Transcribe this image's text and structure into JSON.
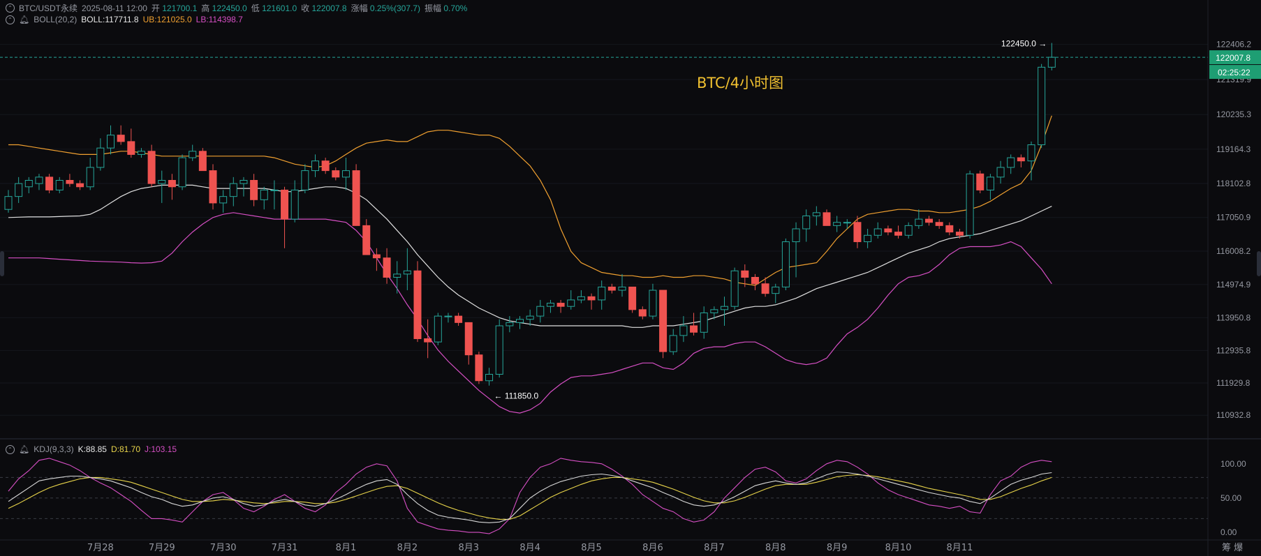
{
  "header": {
    "symbol": "BTC/USDT永续",
    "datetime": "2025-08-11 12:00",
    "open_label": "开",
    "open": "121700.1",
    "high_label": "高",
    "high": "122450.0",
    "low_label": "低",
    "low": "121601.0",
    "close_label": "收",
    "close": "122007.8",
    "change_label": "涨幅",
    "change": "0.25%(307.7)",
    "amplitude_label": "振幅",
    "amplitude": "0.70%"
  },
  "boll": {
    "name": "BOLL(20,2)",
    "mid": "BOLL:117711.8",
    "ub": "UB:121025.0",
    "lb": "LB:114398.7"
  },
  "kdj_header": {
    "name": "KDJ(9,3,3)",
    "k": "K:88.85",
    "d": "D:81.70",
    "j": "J:103.15"
  },
  "time_axis_right_label": "筹 爆",
  "colors": {
    "background": "#0b0b0e",
    "up": "#26a69a",
    "down": "#ef5350",
    "boll_mid": "#e0e0e0",
    "boll_ub": "#f0a030",
    "boll_lb": "#d64fc4",
    "k_line": "#d8d8d8",
    "d_line": "#e8d44a",
    "j_line": "#d64fc4",
    "annotation": "#f0c030",
    "price_tag": "#1e9e73"
  },
  "chart_data": {
    "type": "candlestick",
    "title": "BTC/4小时图",
    "x_tick_labels": [
      "7月28",
      "7月29",
      "7月30",
      "7月31",
      "8月1",
      "8月2",
      "8月3",
      "8月4",
      "8月5",
      "8月6",
      "8月7",
      "8月8",
      "8月9",
      "8月10",
      "8月11"
    ],
    "y_tick_labels": [
      "122406.2",
      "121319.9",
      "120235.3",
      "119164.3",
      "118102.8",
      "117050.9",
      "116008.2",
      "114974.9",
      "113950.8",
      "112935.8",
      "111929.8",
      "110932.8"
    ],
    "ylim": [
      110700,
      122700
    ],
    "current_price": "122007.8",
    "countdown": "02:25:22",
    "high_marker": "122450.0",
    "low_marker": "111850.0",
    "candles": [
      {
        "o": 117300,
        "h": 117900,
        "l": 117200,
        "c": 117700
      },
      {
        "o": 117700,
        "h": 118300,
        "l": 117500,
        "c": 118100
      },
      {
        "o": 118000,
        "h": 118300,
        "l": 117800,
        "c": 118200
      },
      {
        "o": 118100,
        "h": 118400,
        "l": 117900,
        "c": 118300
      },
      {
        "o": 118300,
        "h": 118400,
        "l": 117800,
        "c": 117900
      },
      {
        "o": 117900,
        "h": 118300,
        "l": 117800,
        "c": 118200
      },
      {
        "o": 118200,
        "h": 118400,
        "l": 118000,
        "c": 118100
      },
      {
        "o": 118100,
        "h": 118200,
        "l": 117900,
        "c": 118000
      },
      {
        "o": 118000,
        "h": 118900,
        "l": 117900,
        "c": 118600
      },
      {
        "o": 118600,
        "h": 119500,
        "l": 118500,
        "c": 119200
      },
      {
        "o": 119200,
        "h": 119900,
        "l": 119000,
        "c": 119600
      },
      {
        "o": 119600,
        "h": 119900,
        "l": 119300,
        "c": 119400
      },
      {
        "o": 119400,
        "h": 119800,
        "l": 118900,
        "c": 119000
      },
      {
        "o": 119000,
        "h": 119200,
        "l": 118900,
        "c": 119100
      },
      {
        "o": 119100,
        "h": 119300,
        "l": 118000,
        "c": 118100
      },
      {
        "o": 118100,
        "h": 118500,
        "l": 117500,
        "c": 118200
      },
      {
        "o": 118200,
        "h": 118400,
        "l": 117600,
        "c": 118000
      },
      {
        "o": 118000,
        "h": 119000,
        "l": 117900,
        "c": 118900
      },
      {
        "o": 118900,
        "h": 119300,
        "l": 118800,
        "c": 119100
      },
      {
        "o": 119100,
        "h": 119200,
        "l": 118500,
        "c": 118500
      },
      {
        "o": 118500,
        "h": 118700,
        "l": 117300,
        "c": 117500
      },
      {
        "o": 117500,
        "h": 117900,
        "l": 117200,
        "c": 117700
      },
      {
        "o": 117700,
        "h": 118300,
        "l": 117400,
        "c": 118100
      },
      {
        "o": 118100,
        "h": 118300,
        "l": 117700,
        "c": 118200
      },
      {
        "o": 118200,
        "h": 118400,
        "l": 117400,
        "c": 117600
      },
      {
        "o": 117600,
        "h": 118000,
        "l": 117300,
        "c": 117900
      },
      {
        "o": 117900,
        "h": 118200,
        "l": 117300,
        "c": 117900
      },
      {
        "o": 117900,
        "h": 118000,
        "l": 116100,
        "c": 117000
      },
      {
        "o": 117000,
        "h": 118200,
        "l": 116900,
        "c": 117900
      },
      {
        "o": 117900,
        "h": 118700,
        "l": 117800,
        "c": 118500
      },
      {
        "o": 118500,
        "h": 119000,
        "l": 118300,
        "c": 118800
      },
      {
        "o": 118800,
        "h": 118900,
        "l": 118400,
        "c": 118500
      },
      {
        "o": 118500,
        "h": 118600,
        "l": 118200,
        "c": 118300
      },
      {
        "o": 118300,
        "h": 118900,
        "l": 117900,
        "c": 118500
      },
      {
        "o": 118500,
        "h": 118700,
        "l": 116800,
        "c": 116800
      },
      {
        "o": 116800,
        "h": 117000,
        "l": 115900,
        "c": 115900
      },
      {
        "o": 115900,
        "h": 116100,
        "l": 115400,
        "c": 115800
      },
      {
        "o": 115800,
        "h": 116100,
        "l": 115000,
        "c": 115200
      },
      {
        "o": 115200,
        "h": 115700,
        "l": 114700,
        "c": 115300
      },
      {
        "o": 115300,
        "h": 116100,
        "l": 114800,
        "c": 115400
      },
      {
        "o": 115400,
        "h": 115700,
        "l": 113200,
        "c": 113300
      },
      {
        "o": 113300,
        "h": 113900,
        "l": 112700,
        "c": 113200
      },
      {
        "o": 113200,
        "h": 114100,
        "l": 113100,
        "c": 114000
      },
      {
        "o": 114000,
        "h": 114100,
        "l": 113800,
        "c": 114000
      },
      {
        "o": 114000,
        "h": 114100,
        "l": 113700,
        "c": 113800
      },
      {
        "o": 113800,
        "h": 113800,
        "l": 112500,
        "c": 112800
      },
      {
        "o": 112800,
        "h": 112900,
        "l": 111900,
        "c": 112000
      },
      {
        "o": 112000,
        "h": 112400,
        "l": 111850,
        "c": 112200
      },
      {
        "o": 112200,
        "h": 113900,
        "l": 112100,
        "c": 113700
      },
      {
        "o": 113700,
        "h": 114000,
        "l": 113500,
        "c": 113800
      },
      {
        "o": 113800,
        "h": 114000,
        "l": 113600,
        "c": 113900
      },
      {
        "o": 113900,
        "h": 114200,
        "l": 113700,
        "c": 114000
      },
      {
        "o": 114000,
        "h": 114500,
        "l": 113800,
        "c": 114300
      },
      {
        "o": 114300,
        "h": 114500,
        "l": 114100,
        "c": 114400
      },
      {
        "o": 114400,
        "h": 114500,
        "l": 114100,
        "c": 114300
      },
      {
        "o": 114300,
        "h": 114800,
        "l": 114200,
        "c": 114500
      },
      {
        "o": 114500,
        "h": 114800,
        "l": 114400,
        "c": 114600
      },
      {
        "o": 114600,
        "h": 114700,
        "l": 114200,
        "c": 114500
      },
      {
        "o": 114500,
        "h": 115100,
        "l": 114200,
        "c": 114900
      },
      {
        "o": 114900,
        "h": 115000,
        "l": 114700,
        "c": 114800
      },
      {
        "o": 114800,
        "h": 115300,
        "l": 114600,
        "c": 114900
      },
      {
        "o": 114900,
        "h": 114900,
        "l": 114100,
        "c": 114200
      },
      {
        "o": 114200,
        "h": 114300,
        "l": 113900,
        "c": 114000
      },
      {
        "o": 114000,
        "h": 115000,
        "l": 113900,
        "c": 114800
      },
      {
        "o": 114800,
        "h": 114800,
        "l": 112700,
        "c": 112900
      },
      {
        "o": 112900,
        "h": 113600,
        "l": 112800,
        "c": 113400
      },
      {
        "o": 113400,
        "h": 114000,
        "l": 113200,
        "c": 113700
      },
      {
        "o": 113700,
        "h": 114100,
        "l": 113400,
        "c": 113500
      },
      {
        "o": 113500,
        "h": 114300,
        "l": 113300,
        "c": 114100
      },
      {
        "o": 114100,
        "h": 114300,
        "l": 113900,
        "c": 114200
      },
      {
        "o": 114200,
        "h": 114600,
        "l": 113700,
        "c": 114300
      },
      {
        "o": 114300,
        "h": 115500,
        "l": 114200,
        "c": 115400
      },
      {
        "o": 115400,
        "h": 115600,
        "l": 114900,
        "c": 115200
      },
      {
        "o": 115200,
        "h": 115300,
        "l": 114800,
        "c": 115000
      },
      {
        "o": 115000,
        "h": 115200,
        "l": 114600,
        "c": 114700
      },
      {
        "o": 114700,
        "h": 115000,
        "l": 114400,
        "c": 114900
      },
      {
        "o": 114900,
        "h": 116400,
        "l": 114800,
        "c": 116300
      },
      {
        "o": 116300,
        "h": 116900,
        "l": 115200,
        "c": 116700
      },
      {
        "o": 116700,
        "h": 117300,
        "l": 116300,
        "c": 117100
      },
      {
        "o": 117100,
        "h": 117400,
        "l": 116800,
        "c": 117200
      },
      {
        "o": 117200,
        "h": 117300,
        "l": 116800,
        "c": 116800
      },
      {
        "o": 116800,
        "h": 117100,
        "l": 116600,
        "c": 116900
      },
      {
        "o": 116900,
        "h": 117000,
        "l": 116700,
        "c": 116900
      },
      {
        "o": 116900,
        "h": 117100,
        "l": 116100,
        "c": 116300
      },
      {
        "o": 116300,
        "h": 116700,
        "l": 116100,
        "c": 116500
      },
      {
        "o": 116500,
        "h": 116900,
        "l": 116400,
        "c": 116700
      },
      {
        "o": 116700,
        "h": 116800,
        "l": 116500,
        "c": 116600
      },
      {
        "o": 116600,
        "h": 116800,
        "l": 116400,
        "c": 116500
      },
      {
        "o": 116500,
        "h": 116900,
        "l": 116400,
        "c": 116800
      },
      {
        "o": 116800,
        "h": 117300,
        "l": 116700,
        "c": 117000
      },
      {
        "o": 117000,
        "h": 117100,
        "l": 116800,
        "c": 116900
      },
      {
        "o": 116900,
        "h": 117000,
        "l": 116700,
        "c": 116800
      },
      {
        "o": 116800,
        "h": 116900,
        "l": 116500,
        "c": 116600
      },
      {
        "o": 116600,
        "h": 116700,
        "l": 116400,
        "c": 116500
      },
      {
        "o": 116500,
        "h": 118500,
        "l": 116400,
        "c": 118400
      },
      {
        "o": 118400,
        "h": 118500,
        "l": 117800,
        "c": 117900
      },
      {
        "o": 117900,
        "h": 118400,
        "l": 117600,
        "c": 118300
      },
      {
        "o": 118300,
        "h": 118800,
        "l": 118100,
        "c": 118600
      },
      {
        "o": 118600,
        "h": 119000,
        "l": 118400,
        "c": 118900
      },
      {
        "o": 118900,
        "h": 119000,
        "l": 118600,
        "c": 118800
      },
      {
        "o": 118800,
        "h": 119400,
        "l": 118200,
        "c": 119300
      },
      {
        "o": 119300,
        "h": 121800,
        "l": 119200,
        "c": 121700
      },
      {
        "o": 121700,
        "h": 122450,
        "l": 121601,
        "c": 122007.8
      }
    ],
    "boll_mid": [
      117050,
      117060,
      117070,
      117070,
      117070,
      117080,
      117090,
      117100,
      117150,
      117300,
      117500,
      117700,
      117850,
      117950,
      118000,
      118050,
      118050,
      118050,
      118050,
      118000,
      117950,
      117950,
      117950,
      117950,
      117950,
      117950,
      117900,
      117850,
      117850,
      117900,
      117950,
      118000,
      118000,
      117950,
      117800,
      117600,
      117300,
      117000,
      116650,
      116300,
      115900,
      115550,
      115200,
      114900,
      114650,
      114450,
      114250,
      114100,
      113950,
      113850,
      113800,
      113750,
      113700,
      113700,
      113700,
      113700,
      113700,
      113700,
      113700,
      113700,
      113700,
      113650,
      113650,
      113700,
      113700,
      113700,
      113750,
      113800,
      113850,
      113950,
      114050,
      114150,
      114250,
      114300,
      114300,
      114350,
      114450,
      114550,
      114700,
      114850,
      114950,
      115050,
      115150,
      115250,
      115350,
      115500,
      115650,
      115800,
      115950,
      116050,
      116150,
      116300,
      116400,
      116450,
      116500,
      116550,
      116650,
      116750,
      116850,
      116950,
      117100,
      117250,
      117400
    ],
    "boll_ub": [
      119300,
      119300,
      119250,
      119200,
      119150,
      119100,
      119050,
      119000,
      119000,
      119000,
      119050,
      119100,
      119100,
      119050,
      119000,
      118950,
      118950,
      118950,
      118950,
      118950,
      118950,
      118950,
      118950,
      118950,
      118950,
      118950,
      118900,
      118800,
      118700,
      118650,
      118600,
      118650,
      118800,
      119000,
      119200,
      119350,
      119400,
      119450,
      119400,
      119400,
      119550,
      119700,
      119750,
      119750,
      119700,
      119650,
      119600,
      119600,
      119500,
      119250,
      118950,
      118650,
      118200,
      117600,
      116700,
      116000,
      115650,
      115500,
      115350,
      115300,
      115250,
      115250,
      115200,
      115200,
      115250,
      115200,
      115200,
      115250,
      115250,
      115200,
      115150,
      115050,
      115000,
      114950,
      115150,
      115350,
      115500,
      115550,
      115600,
      115650,
      116000,
      116400,
      116700,
      117000,
      117150,
      117200,
      117250,
      117300,
      117300,
      117250,
      117250,
      117200,
      117200,
      117250,
      117300,
      117400,
      117550,
      117750,
      117950,
      118100,
      118500,
      119300,
      120200
    ],
    "boll_lb": [
      115800,
      115800,
      115800,
      115800,
      115780,
      115760,
      115740,
      115720,
      115700,
      115690,
      115680,
      115670,
      115650,
      115640,
      115650,
      115700,
      115950,
      116300,
      116600,
      116850,
      117050,
      117150,
      117200,
      117150,
      117100,
      117050,
      117000,
      117000,
      117000,
      117000,
      117000,
      117000,
      116950,
      116900,
      116650,
      116300,
      115800,
      115300,
      114850,
      114350,
      113900,
      113400,
      112950,
      112600,
      112300,
      112000,
      111700,
      111450,
      111200,
      111050,
      111000,
      111100,
      111300,
      111650,
      111900,
      112100,
      112150,
      112150,
      112200,
      112250,
      112350,
      112450,
      112550,
      112550,
      112400,
      112350,
      112550,
      112850,
      113000,
      113050,
      113050,
      113150,
      113200,
      113200,
      113050,
      112850,
      112650,
      112550,
      112500,
      112550,
      112700,
      113100,
      113450,
      113650,
      113900,
      114250,
      114650,
      115000,
      115200,
      115250,
      115350,
      115600,
      115900,
      116100,
      116150,
      116150,
      116150,
      116200,
      116300,
      116150,
      115800,
      115450,
      115000
    ]
  },
  "kdj": {
    "y_tick_labels": [
      "100.00",
      "50.00",
      "0.00"
    ],
    "ylim": [
      -5,
      115
    ],
    "guide_levels": [
      20,
      50,
      80
    ],
    "K": [
      45,
      55,
      65,
      75,
      78,
      80,
      82,
      82,
      80,
      78,
      75,
      70,
      65,
      58,
      52,
      48,
      42,
      38,
      40,
      45,
      50,
      52,
      48,
      42,
      38,
      40,
      45,
      48,
      45,
      40,
      38,
      42,
      48,
      55,
      63,
      70,
      75,
      77,
      70,
      55,
      42,
      32,
      25,
      22,
      20,
      18,
      15,
      14,
      15,
      20,
      35,
      50,
      60,
      68,
      74,
      78,
      82,
      84,
      85,
      83,
      80,
      75,
      70,
      65,
      58,
      52,
      45,
      40,
      38,
      40,
      45,
      52,
      60,
      68,
      72,
      75,
      72,
      70,
      72,
      78,
      84,
      88,
      87,
      85,
      82,
      78,
      74,
      70,
      66,
      62,
      58,
      55,
      52,
      50,
      45,
      42,
      50,
      60,
      70,
      76,
      80,
      85,
      87
    ],
    "D": [
      35,
      42,
      50,
      58,
      65,
      70,
      74,
      78,
      80,
      80,
      78,
      76,
      73,
      68,
      63,
      58,
      53,
      48,
      45,
      45,
      46,
      48,
      47,
      45,
      43,
      42,
      43,
      45,
      45,
      44,
      42,
      42,
      44,
      48,
      53,
      58,
      63,
      67,
      68,
      64,
      57,
      50,
      43,
      37,
      32,
      28,
      24,
      21,
      19,
      19,
      24,
      33,
      42,
      51,
      58,
      64,
      70,
      75,
      78,
      80,
      80,
      78,
      76,
      73,
      68,
      63,
      57,
      51,
      46,
      43,
      43,
      46,
      51,
      57,
      63,
      68,
      70,
      70,
      70,
      73,
      77,
      81,
      83,
      84,
      83,
      81,
      78,
      75,
      72,
      68,
      64,
      61,
      58,
      55,
      52,
      48,
      48,
      52,
      58,
      64,
      69,
      75,
      80
    ],
    "J": [
      60,
      78,
      90,
      105,
      108,
      103,
      98,
      90,
      80,
      72,
      65,
      55,
      45,
      32,
      20,
      20,
      18,
      15,
      30,
      45,
      55,
      58,
      48,
      35,
      30,
      38,
      48,
      55,
      45,
      35,
      30,
      40,
      58,
      70,
      85,
      95,
      100,
      97,
      75,
      35,
      15,
      10,
      5,
      3,
      2,
      0,
      0,
      -2,
      5,
      20,
      58,
      80,
      95,
      100,
      108,
      105,
      103,
      102,
      100,
      92,
      82,
      70,
      55,
      45,
      35,
      30,
      20,
      15,
      18,
      30,
      50,
      65,
      80,
      92,
      95,
      88,
      75,
      72,
      78,
      90,
      100,
      105,
      103,
      95,
      85,
      72,
      62,
      55,
      50,
      45,
      40,
      38,
      35,
      38,
      30,
      28,
      55,
      75,
      82,
      95,
      102,
      105,
      103
    ]
  }
}
